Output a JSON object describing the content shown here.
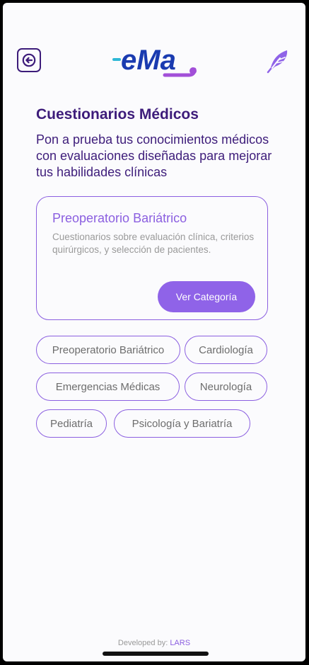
{
  "header": {
    "logo_text": "eMa",
    "back_icon": "arrow-left-icon",
    "feather_icon": "feather-icon"
  },
  "page": {
    "title": "Cuestionarios Médicos",
    "subtitle": "Pon a prueba tus conocimientos médicos con evaluaciones diseñadas para mejorar tus habilidades clínicas"
  },
  "featured": {
    "title": "Preoperatorio Bariátrico",
    "description": "Cuestionarios sobre evaluación clínica, criterios quirúrgicos, y selección de pacientes.",
    "button_label": "Ver Categoría"
  },
  "categories": [
    "Preoperatorio Bariátrico",
    "Cardiología",
    "Emergencias Médicas",
    "Neurología",
    "Pediatría",
    "Psicología y Bariatría"
  ],
  "footer": {
    "prefix": "Developed by: ",
    "brand": "LARS"
  },
  "colors": {
    "primary": "#3d1c7a",
    "accent": "#8b5fe0",
    "button": "#8f63e8",
    "logo_blue": "#1a3bb0",
    "logo_purple": "#a24fd8",
    "logo_cyan": "#2fb8d6"
  }
}
